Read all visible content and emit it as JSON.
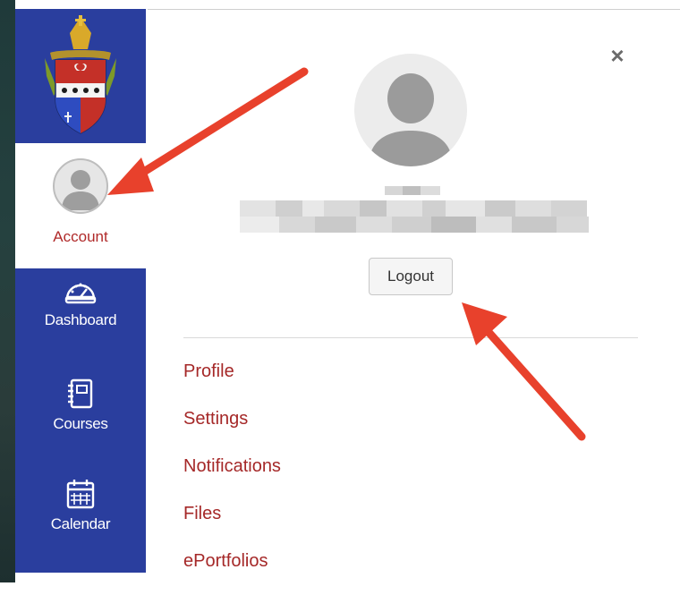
{
  "global_nav": {
    "account_label": "Account",
    "items": [
      {
        "label": "Dashboard",
        "icon": "dashboard-gauge-icon"
      },
      {
        "label": "Courses",
        "icon": "courses-book-icon"
      },
      {
        "label": "Calendar",
        "icon": "calendar-icon"
      }
    ],
    "logo": "diocese-coat-of-arms-logo"
  },
  "tray": {
    "close_icon": "close-icon",
    "logout_label": "Logout",
    "links": [
      "Profile",
      "Settings",
      "Notifications",
      "Files",
      "ePortfolios"
    ]
  },
  "colors": {
    "nav_background": "#2a3e9e",
    "link_red": "#a52828",
    "annotation_arrow": "#e8412c"
  }
}
